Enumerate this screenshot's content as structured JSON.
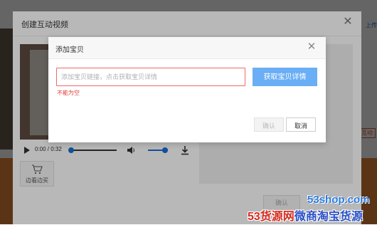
{
  "background": {
    "right_text": "上传",
    "left_tag": "",
    "right_tag": "互动"
  },
  "outer_modal": {
    "title": "创建互动视频",
    "close_glyph": "✕",
    "player": {
      "time": "0:00 / 0:32",
      "progress_fraction": 0.0,
      "volume_fraction": 0.8
    },
    "cart_label": "边看边买",
    "confirm_label": "确认"
  },
  "inner_modal": {
    "title": "添加宝贝",
    "close_glyph": "✕",
    "link_input": {
      "value": "",
      "placeholder": "添加宝贝链接，点击获取宝贝详情"
    },
    "fetch_button_label": "获取宝贝详情",
    "error_text": "不能为空",
    "confirm_label": "确认",
    "cancel_label": "取消"
  },
  "watermark": {
    "url": "53shop.com",
    "brand_53": "53货源网",
    "brand_rest": "微商淘宝货源"
  },
  "colors": {
    "accent_blue": "#6aaef5",
    "error_red": "#e03c3c",
    "orange": "#e8863a"
  }
}
